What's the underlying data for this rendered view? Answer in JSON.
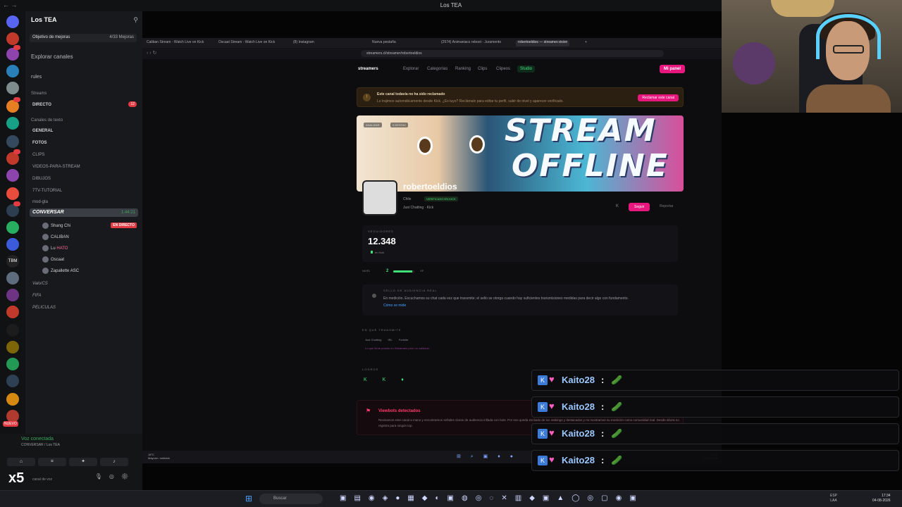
{
  "window": {
    "title": "Los TEA"
  },
  "discord": {
    "server_name": "Los TEA",
    "objective": {
      "label": "Objetivo de mejoras",
      "count": "4/33 Mejoras"
    },
    "explore": "Explorar canales",
    "rules": "rules",
    "categories": {
      "streams": "Streams",
      "text": "Canales de texto"
    },
    "channels": {
      "directo": "DIRECTO",
      "directo_badge": "12",
      "general": "GENERAL",
      "fotos": "FOTOS",
      "clips": "CLIPS",
      "videos": "VIDEOS-PARA-STREAM",
      "dibujos": "DIBUJOS",
      "tutorial": "7TV-TUTORIAL",
      "mod": "mod-gta"
    },
    "active_voice": {
      "label": "CONVERSAR",
      "time": "1:44:21"
    },
    "voice_users": [
      {
        "name": "Shang Chi"
      },
      {
        "name": "CALIBAN"
      },
      {
        "name": "Lu",
        "tag": "HATO"
      },
      {
        "name": "Oscaat"
      },
      {
        "name": "Zapallette",
        "tag": "ASC"
      }
    ],
    "live_badge": "EN DIRECTO",
    "more_voice": [
      "Valo/CS",
      "FIFA",
      "PELICULAS"
    ],
    "voice_status": {
      "status": "Voz conectada",
      "channel": "CONVERSAR / Los TEA"
    },
    "new_badge": "NUEVO",
    "self_label": "canal de voz"
  },
  "browser": {
    "tabs": [
      "Caliban Stream - Watch Live on Kick",
      "Oscaat Stream - Watch Live on Kick",
      "(8) Instagram",
      "Nueva pestaña",
      "(2574) Animaniacs reboot - Juramento",
      "robertoeldios — streamer.vision",
      "+"
    ],
    "url": "streamers.cl/streamer/robertoeldios"
  },
  "site": {
    "logo": "streamers",
    "nav": [
      "Explorar",
      "Categorías",
      "Ranking",
      "Clips",
      "Clipeos"
    ],
    "studio": "Studio",
    "panel": "Mi panel",
    "banner": {
      "title": "Este canal todavía no ha sido reclamado",
      "text": "Lo trajimos automáticamente desde Kick. ¿Es tuyo? Reclámalo para editar tu perfil, subir de nivel y aparecer verificado.",
      "button": "Reclamar este canal"
    },
    "cover_text": [
      "STREAM",
      "OFFLINE"
    ],
    "cover_chips": [
      "ANALIZAR",
      "0 DESTAC"
    ],
    "profile": {
      "name": "robertoeldios",
      "country": "Chile",
      "verified": "VERIFICADO EN KICK",
      "category": "Just Chatting · Kick",
      "follow": "Seguir",
      "report": "Reportar"
    },
    "followers": {
      "label": "SEGUIDORES",
      "value": "12.348",
      "platform": "en Kick"
    },
    "level": {
      "label": "NIVEL",
      "value": "2",
      "progress": 0.9,
      "max": "XP"
    },
    "seal": {
      "title": "SELLO DE AUDIENCIA REAL",
      "text": "En medición. Escuchamos su chat cada vez que transmite; el sello se otorga cuando hay suficientes transmisiones medidas para decir algo con fundamento.",
      "link": "Cómo se mide"
    },
    "transmits": {
      "title": "EN QUE TRANSMITE",
      "tags": [
        "Just Chatting",
        "IRL",
        "Fortnite"
      ],
      "note": "Lo que tiene puesto en Streamers pero no validado"
    },
    "achievements": {
      "title": "LOGROS"
    },
    "viewbots": {
      "title": "Viewbots detectados",
      "text": "Revisamos este canal a mano y encontramos señales claras de audiencia inflada con bots. Por eso queda excluido de los rankings y destacados y no mostramos su medición como comunidad real. Desde ahora no registra para ningún top."
    },
    "weather": {
      "temp": "18°C",
      "desc": "Mayorm. nublado"
    }
  },
  "chat_messages": [
    {
      "user": "Kaito28",
      "emote": "🥒"
    },
    {
      "user": "Kaito28",
      "emote": "🥒"
    },
    {
      "user": "Kaito28",
      "emote": "🥒"
    },
    {
      "user": "Kaito28",
      "emote": "🥒"
    }
  ],
  "taskbar": {
    "search": "Buscar",
    "lang": "ESP",
    "region": "LAA",
    "time": "17:34",
    "date": "04-08-2026"
  },
  "colors": {
    "accent": "#e8177e",
    "kick_green": "#3fe07a",
    "discord_bg": "#18191c"
  }
}
